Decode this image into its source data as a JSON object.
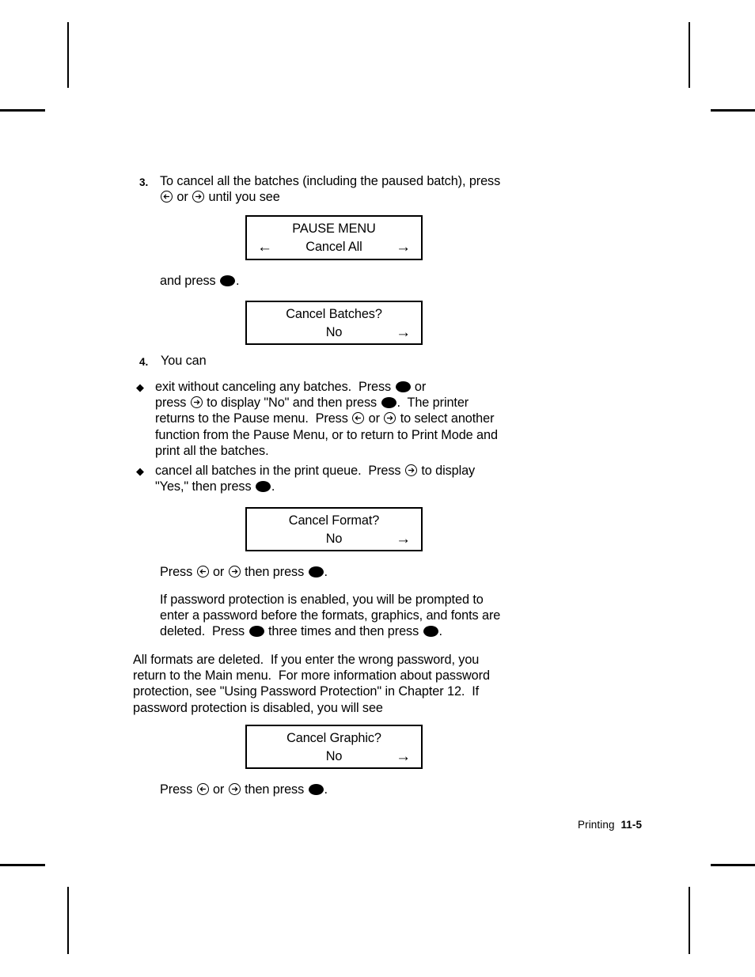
{
  "page": {
    "footer_label": "Printing",
    "footer_page": "11-5"
  },
  "steps": [
    {
      "number": "3.",
      "text": "To cancel all the batches (including the paused batch), press\n<KEY_LEFT> or <KEY_RIGHT> until you see"
    },
    {
      "number": "4.",
      "text": "You can"
    }
  ],
  "paragraphs": {
    "and_press": "and press <KEY_DOT>.",
    "press_arrows_1": "Press <KEY_LEFT> or <KEY_RIGHT> then press <KEY_DOT>.",
    "password_note": "If password protection is enabled, you will be prompted to\nenter a password before the formats, graphics, and fonts are\ndeleted.  Press <KEY_DOT> three times and then press <KEY_DOT>.",
    "all_formats": "All formats are deleted.  If you enter the wrong password, you\nreturn to the Main menu.  For more information about password\nprotection, see \"Using Password Protection\" in Chapter 12.  If\npassword protection is disabled, you will see",
    "press_arrows_2": "Press <KEY_LEFT> or <KEY_RIGHT> then press <KEY_DOT>."
  },
  "bullets": [
    {
      "marker": "◆",
      "text": "exit without canceling any batches.  Press <KEY_DOT> or\npress <KEY_RIGHT> to display \"No\" and then press <KEY_DOT>.  The printer\nreturns to the Pause menu.  Press <KEY_LEFT> or <KEY_RIGHT> to select another\nfunction from the Pause Menu, or to return to Print Mode and\nprint all the batches."
    },
    {
      "marker": "◆",
      "text": "cancel all batches in the print queue.  Press <KEY_RIGHT> to display\n\"Yes,\" then press <KEY_DOT>."
    }
  ],
  "displays": [
    {
      "name": "pause-menu",
      "line1": "PAUSE MENU",
      "line2": "Cancel All",
      "arrow_left": "←",
      "arrow_right": "→"
    },
    {
      "name": "cancel-batches",
      "line1": "Cancel Batches?",
      "line2": "No",
      "arrow_left": "",
      "arrow_right": "→"
    },
    {
      "name": "cancel-format",
      "line1": "Cancel Format?",
      "line2": "No",
      "arrow_left": "",
      "arrow_right": "→"
    },
    {
      "name": "cancel-graphic",
      "line1": "Cancel Graphic?",
      "line2": "No",
      "arrow_left": "",
      "arrow_right": "→"
    }
  ]
}
